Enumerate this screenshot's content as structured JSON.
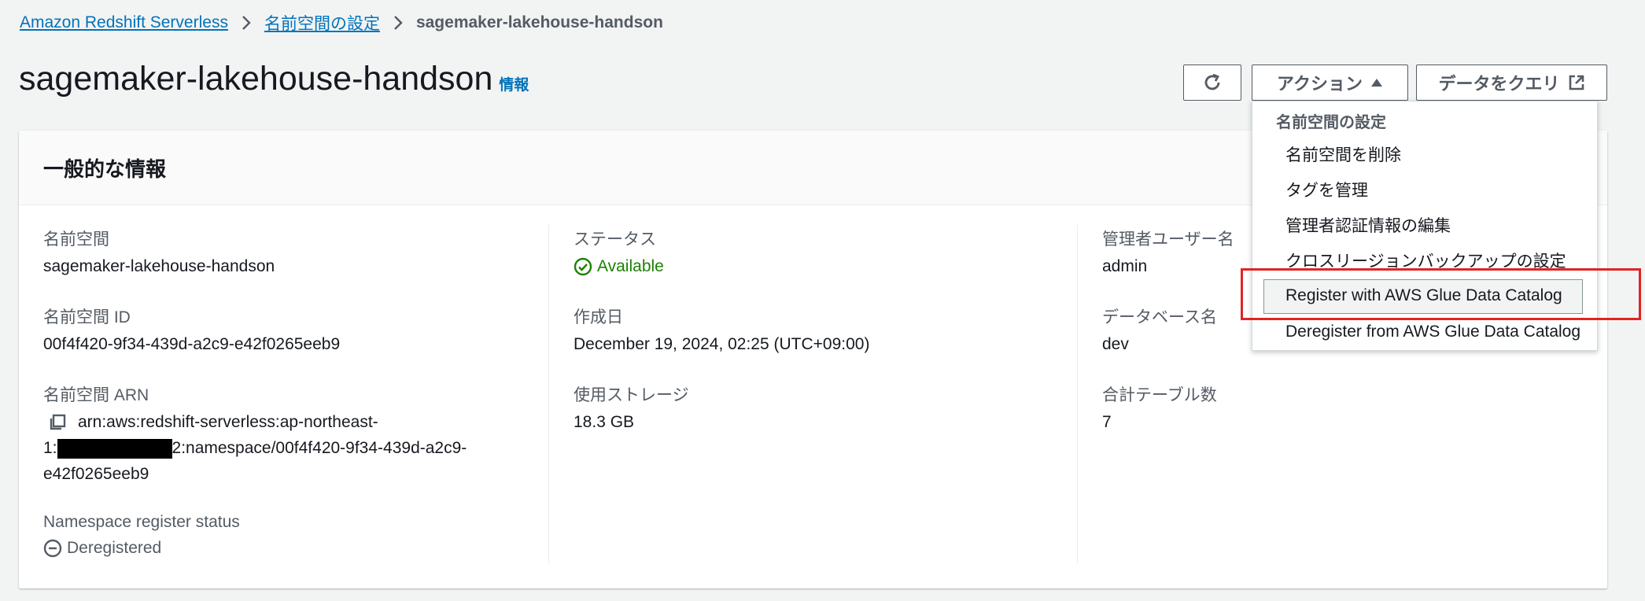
{
  "breadcrumb": {
    "items": [
      "Amazon Redshift Serverless",
      "名前空間の設定"
    ],
    "current": "sagemaker-lakehouse-handson"
  },
  "header": {
    "title": "sagemaker-lakehouse-handson",
    "info": "情報",
    "actions_label": "アクション",
    "query_label": "データをクエリ"
  },
  "panel": {
    "title": "一般的な情報",
    "col1": {
      "namespace_label": "名前空間",
      "namespace_value": "sagemaker-lakehouse-handson",
      "id_label": "名前空間 ID",
      "id_value": "00f4f420-9f34-439d-a2c9-e42f0265eeb9",
      "arn_label": "名前空間 ARN",
      "arn_line1": "arn:aws:redshift-serverless:ap-northeast-",
      "arn_line2_prefix": "1:",
      "arn_line2_suffix": "2:namespace/00f4f420-9f34-439d-a2c9-",
      "arn_line3": "e42f0265eeb9",
      "register_label": "Namespace register status",
      "register_value": "Deregistered"
    },
    "col2": {
      "status_label": "ステータス",
      "status_value": "Available",
      "created_label": "作成日",
      "created_value": "December 19, 2024, 02:25 (UTC+09:00)",
      "storage_label": "使用ストレージ",
      "storage_value": "18.3 GB"
    },
    "col3": {
      "admin_label": "管理者ユーザー名",
      "admin_value": "admin",
      "db_label": "データベース名",
      "db_value": "dev",
      "tables_label": "合計テーブル数",
      "tables_value": "7"
    }
  },
  "dropdown": {
    "group_label": "名前空間の設定",
    "items": [
      "名前空間を削除",
      "タグを管理",
      "管理者認証情報の編集",
      "クロスリージョンバックアップの設定",
      "Register with AWS Glue Data Catalog",
      "Deregister from AWS Glue Data Catalog"
    ]
  },
  "colors": {
    "link": "#0073bb",
    "success": "#1d8102",
    "highlight": "#e02424"
  }
}
